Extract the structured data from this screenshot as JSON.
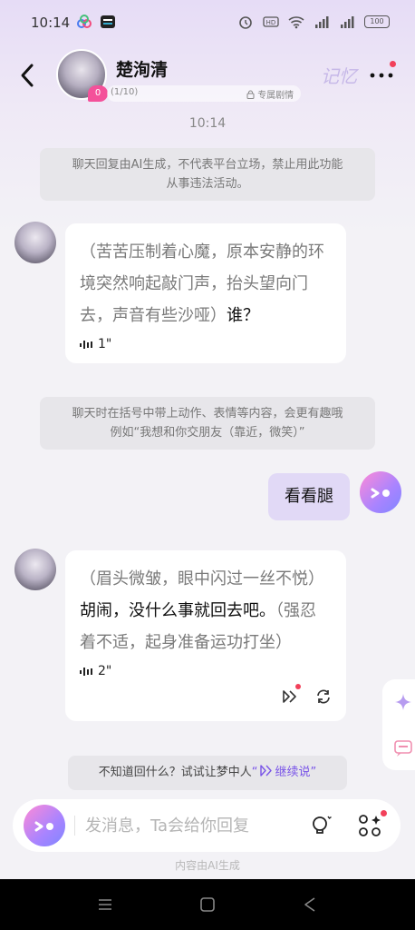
{
  "status_bar": {
    "time": "10:14",
    "battery": "100"
  },
  "header": {
    "name": "楚洵清",
    "intimacy": "0",
    "progress": "(1/10)",
    "exclusive": "专属剧情",
    "memory": "记忆"
  },
  "chat": {
    "time": "10:14",
    "notice1": {
      "line1": "聊天回复由AI生成，不代表平台立场，禁止用此功能",
      "line2": "从事违法活动。"
    },
    "msg1": {
      "action": "（苦苦压制着心魔，原本安静的环境突然响起敲门声，抬头望向门去，声音有些沙哑）",
      "speech": "谁？",
      "duration": "1\""
    },
    "notice2": {
      "line1": "聊天时在括号中带上动作、表情等内容，会更有趣哦",
      "line2": "例如“我想和你交朋友（靠近，微笑）”"
    },
    "user_msg": "看看腿",
    "msg2": {
      "action1": "（眉头微皱，眼中闪过一丝不悦）",
      "speech": "胡闹，没什么事就回去吧。",
      "action2": "（强忍着不适，起身准备运功打坐）",
      "duration": "2\""
    },
    "continue_hint": {
      "prefix": "不知道回什么？试试让梦中人",
      "open_quote": "“",
      "link": "继续说",
      "close_quote": "”"
    }
  },
  "input": {
    "placeholder": "发消息，Ta会给你回复"
  },
  "footer": {
    "ai_generated": "内容由AI生成"
  },
  "colors": {
    "accent": "#7a55e8",
    "badge": "#f4519a",
    "user_bubble": "#e1d9f6"
  }
}
